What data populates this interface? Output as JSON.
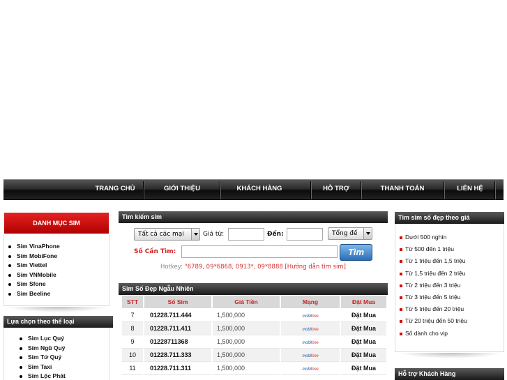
{
  "nav": {
    "items": [
      "TRANG CHỦ",
      "GIỚI THIỆU",
      "KHÁCH HÀNG",
      "HỖ TRỢ",
      "THANH TOÁN",
      "LIÊN HỆ"
    ]
  },
  "left": {
    "catalog_title": "DANH MỤC SIM",
    "catalog_items": [
      "Sim VinaPhone",
      "Sim MobiFone",
      "Sim Viettel",
      "Sim VNMobile",
      "Sim Sfone",
      "Sim Beeline"
    ],
    "category_title": "Lựa chọn theo thể loại",
    "category_items": [
      "Sim Lục Quý",
      "Sim Ngũ Quý",
      "Sim Tứ Quý",
      "Sim Taxi",
      "Sim Lộc Phát"
    ]
  },
  "search": {
    "title": "Tìm kiếm sim",
    "network_select": "Tất cả các mại",
    "price_from_label": "Giá từ:",
    "price_to_label": "Đến:",
    "sum_select": "Tổng đế",
    "number_label": "Số Cần Tìm:",
    "number_value": "",
    "button": "Tìm",
    "hotkey_label": "Hotkey:",
    "hotkey_text": "\"6789, 09*6868, 0913*, 09*8888 [Hướng dẫn tìm sim]"
  },
  "random": {
    "title": "Sim Số Đẹp Ngẫu Nhiên",
    "columns": [
      "STT",
      "Số Sim",
      "Giá Tiền",
      "Mạng",
      "Đặt Mua"
    ],
    "rows": [
      {
        "stt": "7",
        "number": "01228.711.444",
        "price": "1,500,000",
        "network": "mobifone",
        "buy": "Đặt Mua"
      },
      {
        "stt": "8",
        "number": "01228.711.411",
        "price": "1,500,000",
        "network": "mobifone",
        "buy": "Đặt Mua"
      },
      {
        "stt": "9",
        "number": "01228711368",
        "price": "1,500,000",
        "network": "mobifone",
        "buy": "Đặt Mua"
      },
      {
        "stt": "10",
        "number": "01228.711.333",
        "price": "1,500,000",
        "network": "mobifone",
        "buy": "Đặt Mua"
      },
      {
        "stt": "11",
        "number": "01228.711.311",
        "price": "1,500,000",
        "network": "mobifone",
        "buy": "Đặt Mua"
      }
    ]
  },
  "right": {
    "price_title": "Tìm sim số đẹp theo giá",
    "price_items": [
      "Dưới 500 nghìn",
      "Từ 500 đến 1 triệu",
      "Từ 1 triệu đến 1,5 triệu",
      "Từ 1,5 triệu đến 2 triệu",
      "Từ 2 triệu đến 3 triệu",
      "Từ 3 triệu đến 5 triệu",
      "Từ 5 triệu đến 20 triệu",
      "Từ 20 triệu đến 50 triệu",
      "Số dành cho vip"
    ],
    "support_title": "Hỗ trợ Khách Hàng"
  },
  "colors": {
    "accent_red": "#c52525",
    "nav_dark": "#1a1a1a",
    "button_blue": "#2a6fb8"
  }
}
